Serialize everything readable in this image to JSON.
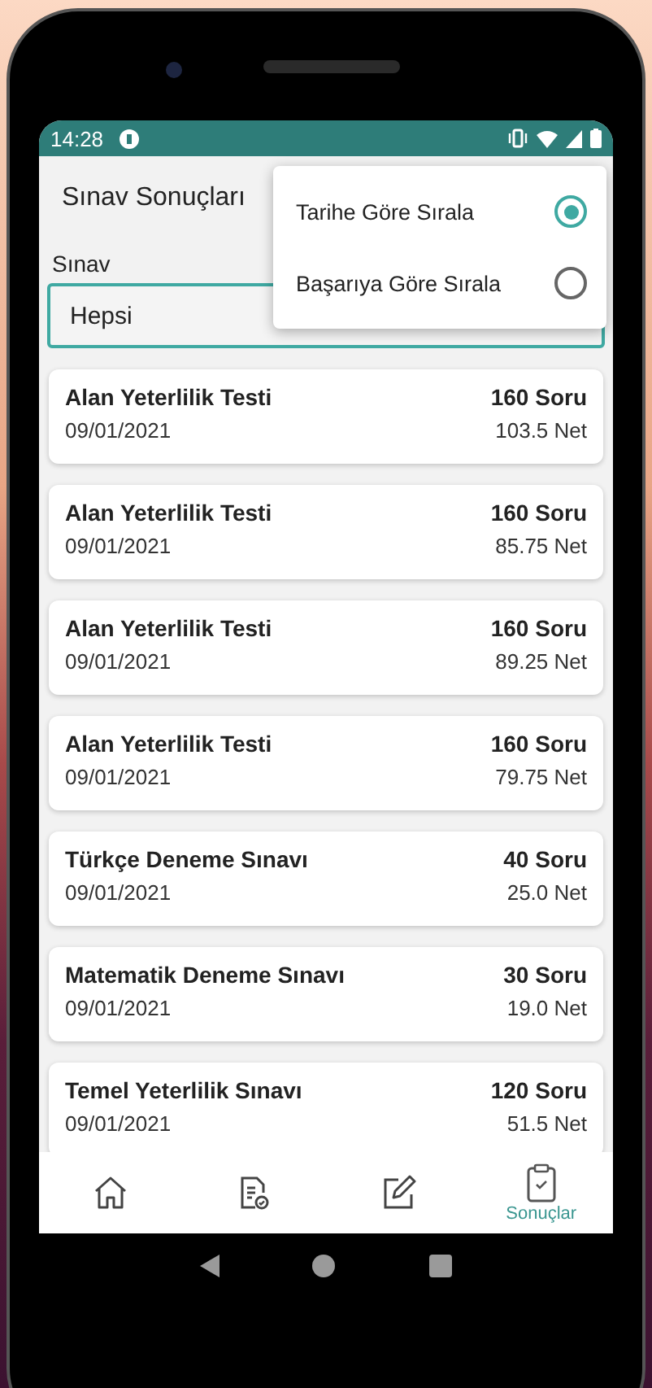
{
  "status_bar": {
    "time": "14:28"
  },
  "header": {
    "title": "Sınav Sonuçları"
  },
  "filter": {
    "label": "Sınav",
    "value": "Hepsi"
  },
  "results": [
    {
      "title": "Alan Yeterlilik Testi",
      "date": "09/01/2021",
      "questions": "160 Soru",
      "net": "103.5 Net"
    },
    {
      "title": "Alan Yeterlilik Testi",
      "date": "09/01/2021",
      "questions": "160 Soru",
      "net": "85.75 Net"
    },
    {
      "title": "Alan Yeterlilik Testi",
      "date": "09/01/2021",
      "questions": "160 Soru",
      "net": "89.25 Net"
    },
    {
      "title": "Alan Yeterlilik Testi",
      "date": "09/01/2021",
      "questions": "160 Soru",
      "net": "79.75 Net"
    },
    {
      "title": "Türkçe Deneme Sınavı",
      "date": "09/01/2021",
      "questions": "40 Soru",
      "net": "25.0 Net"
    },
    {
      "title": "Matematik Deneme Sınavı",
      "date": "09/01/2021",
      "questions": "30 Soru",
      "net": "19.0 Net"
    },
    {
      "title": "Temel Yeterlilik Sınavı",
      "date": "09/01/2021",
      "questions": "120 Soru",
      "net": "51.5 Net"
    }
  ],
  "bottom_nav": [
    {
      "kind": "home",
      "selected": false
    },
    {
      "kind": "tests",
      "selected": false
    },
    {
      "kind": "edit",
      "selected": false
    },
    {
      "kind": "results",
      "label": "Sonuçlar",
      "selected": true
    }
  ],
  "sort_menu": {
    "options": [
      {
        "label": "Tarihe Göre Sırala",
        "selected": true
      },
      {
        "label": "Başarıya Göre Sırala",
        "selected": false
      }
    ]
  }
}
